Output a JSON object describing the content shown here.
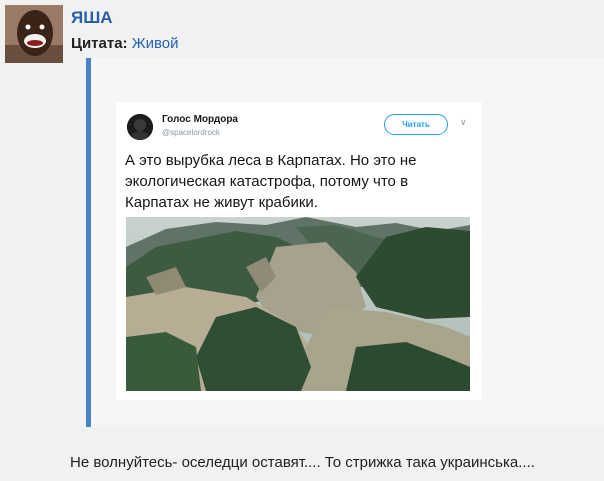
{
  "post": {
    "username": "ЯША",
    "quote_label": "Цитата:",
    "quote_link": "Живой",
    "comment": "Не волнуйтесь- оселедци оставят.... То стрижка така украинська...."
  },
  "tweet": {
    "author": "Голос Мордора",
    "handle": "@spacelordrock",
    "follow_label": "Читать",
    "menu_icon": "chevron-down-icon",
    "text": "А это вырубка леса в Карпатах. Но это не экологическая катастрофа, потому что в Карпатах не живут крабики."
  },
  "colors": {
    "username": "#2a5ea8",
    "link": "#1e63b3",
    "quote_bar": "#4a82c8",
    "follow": "#1da1f2"
  }
}
